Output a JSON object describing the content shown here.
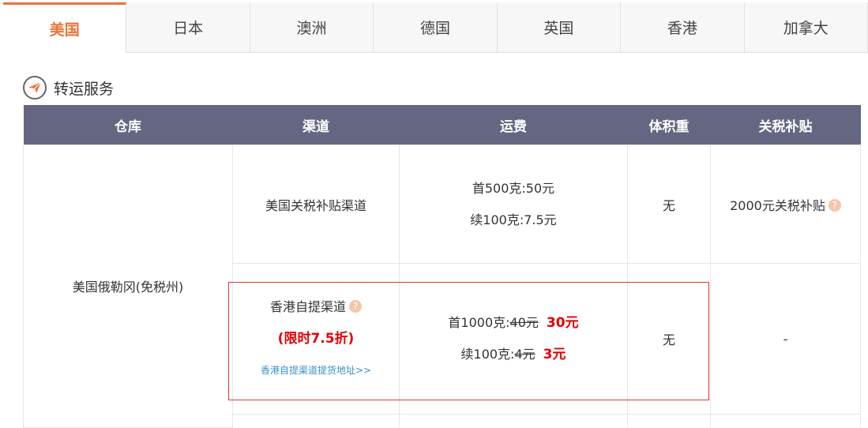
{
  "tabs": [
    "美国",
    "日本",
    "澳洲",
    "德国",
    "英国",
    "香港",
    "加拿大"
  ],
  "section": {
    "title": "转运服务",
    "icon": "paper-plane-icon"
  },
  "table": {
    "headers": [
      "仓库",
      "渠道",
      "运费",
      "体积重",
      "关税补贴"
    ],
    "warehouse": "美国俄勒冈(免税州)",
    "row1": {
      "channel": "美国关税补贴渠道",
      "fee_line1": "首500克:50元",
      "fee_line2": "续100克:7.5元",
      "volume": "无",
      "subsidy": "2000元关税补贴",
      "help": "?"
    },
    "row2": {
      "channel": "香港自提渠道",
      "help": "?",
      "promo": "(限时7.5折)",
      "link": "香港自提渠道提货地址>>",
      "fee1_prefix": "首1000克:",
      "fee1_old": "40元",
      "fee1_new": "30元",
      "fee2_prefix": "续100克:",
      "fee2_old": "4元",
      "fee2_new": "3元",
      "volume": "无",
      "subsidy": "-"
    }
  },
  "colors": {
    "accent": "#e8743b",
    "header_bg": "#656782",
    "promo": "#e40000",
    "link": "#3a8fc9",
    "highlight": "#e03838"
  }
}
